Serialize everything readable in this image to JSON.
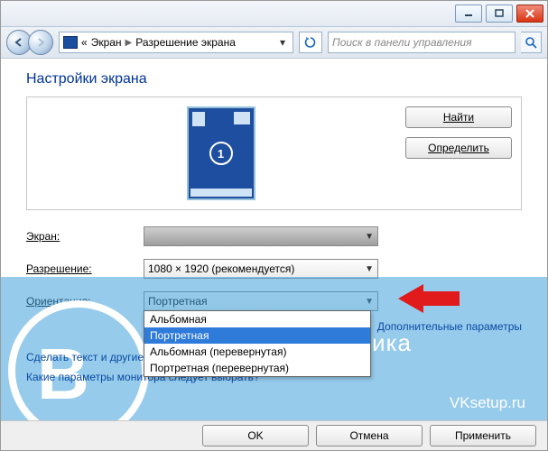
{
  "breadcrumb": {
    "pre": "«",
    "node1": "Экран",
    "node2": "Разрешение экрана"
  },
  "search": {
    "placeholder": "Поиск в панели управления"
  },
  "heading": "Настройки экрана",
  "monitor_badge": "1",
  "buttons": {
    "find": "Найти",
    "detect": "Определить",
    "ok": "OK",
    "cancel": "Отмена",
    "apply": "Применить"
  },
  "rows": {
    "screen": {
      "label": "Экран:",
      "value": ""
    },
    "resolution": {
      "label": "Разрешение:",
      "value": "1080 × 1920 (рекомендуется)"
    },
    "orient": {
      "label": "Ориентация:",
      "value": "Портретная"
    }
  },
  "orient_options": [
    "Альбомная",
    "Портретная",
    "Альбомная (перевернутая)",
    "Портретная (перевернутая)"
  ],
  "links": {
    "advanced": "Дополнительные параметры",
    "textsize": "Сделать текст и другие",
    "whichmon": "Какие параметры монитора следует выбрать?"
  },
  "watermark": {
    "letter": "В",
    "title": "Графика",
    "site": "VKsetup.ru"
  }
}
